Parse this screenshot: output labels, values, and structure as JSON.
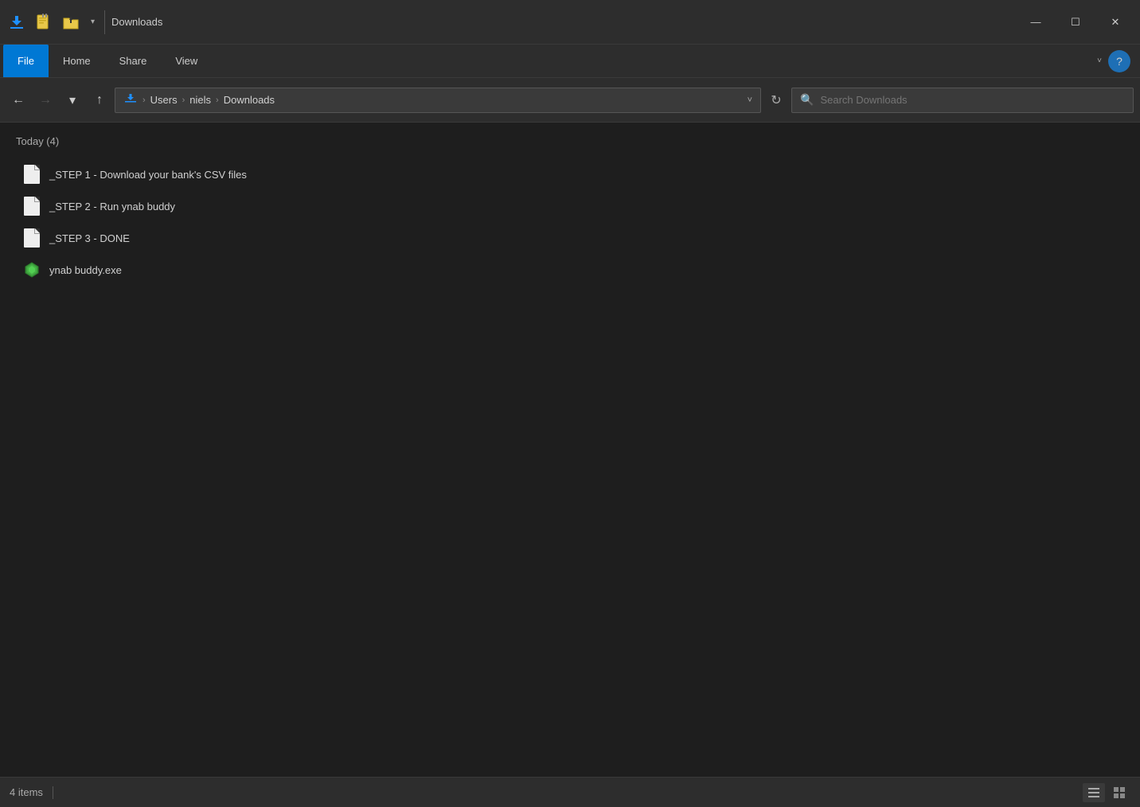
{
  "titlebar": {
    "title": "Downloads",
    "minimize": "—",
    "maximize": "☐",
    "close": "✕"
  },
  "ribbon": {
    "tabs": [
      {
        "label": "File",
        "active": true
      },
      {
        "label": "Home",
        "active": false
      },
      {
        "label": "Share",
        "active": false
      },
      {
        "label": "View",
        "active": false
      }
    ],
    "chevron_down": "˅",
    "help": "?"
  },
  "addressbar": {
    "back": "←",
    "forward": "→",
    "dropdown": "˅",
    "up": "↑",
    "breadcrumb": {
      "segments": [
        "Users",
        "niels",
        "Downloads"
      ]
    },
    "refresh": "↻",
    "search_placeholder": "Search Downloads"
  },
  "content": {
    "group_label": "Today (4)",
    "files": [
      {
        "name": "_STEP 1 - Download your bank's CSV files",
        "type": "doc"
      },
      {
        "name": "_STEP 2 - Run ynab buddy",
        "type": "doc"
      },
      {
        "name": "_STEP 3 - DONE",
        "type": "doc"
      },
      {
        "name": "ynab buddy.exe",
        "type": "exe"
      }
    ]
  },
  "statusbar": {
    "count": "4 items",
    "divider": "|"
  }
}
